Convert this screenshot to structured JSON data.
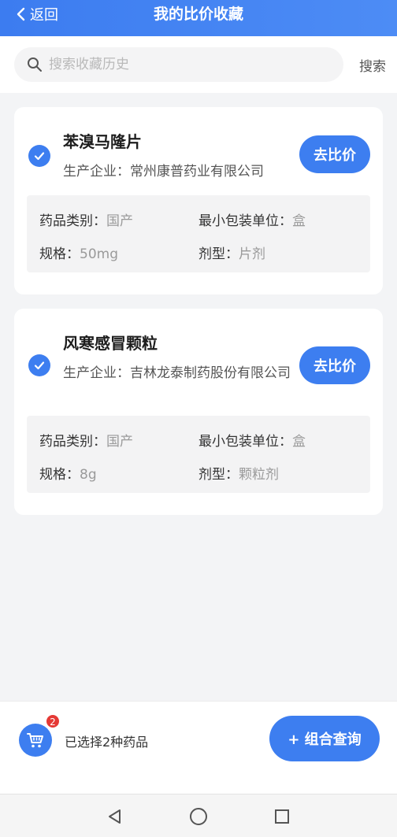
{
  "header": {
    "back_label": "返回",
    "title": "我的比价收藏"
  },
  "search": {
    "placeholder": "搜索收藏历史",
    "button_label": "搜索"
  },
  "drugs": [
    {
      "name": "苯溴马隆片",
      "company_label": "生产企业：",
      "company_value": "常州康普药业有限公司",
      "compare_label": "去比价",
      "checked": true,
      "category_label": "药品类别：",
      "category_value": "国产",
      "unit_label": "最小包装单位：",
      "unit_value": "盒",
      "spec_label": "规格：",
      "spec_value": "50mg",
      "form_label": "剂型：",
      "form_value": "片剂"
    },
    {
      "name": "风寒感冒颗粒",
      "company_label": "生产企业：",
      "company_value": "吉林龙泰制药股份有限公司",
      "compare_label": "去比价",
      "checked": true,
      "category_label": "药品类别：",
      "category_value": "国产",
      "unit_label": "最小包装单位：",
      "unit_value": "盒",
      "spec_label": "规格：",
      "spec_value": "8g",
      "form_label": "剂型：",
      "form_value": "颗粒剂"
    }
  ],
  "bottom": {
    "cart_count": "2",
    "selected_text": "已选择2种药品",
    "combo_label": "+ 组合查询"
  },
  "colors": {
    "accent": "#3d7ef0",
    "badge": "#e53935"
  },
  "icons": [
    "chevron-left-icon",
    "search-icon",
    "check-icon",
    "cart-icon",
    "nav-back-icon",
    "nav-home-icon",
    "nav-recents-icon"
  ]
}
